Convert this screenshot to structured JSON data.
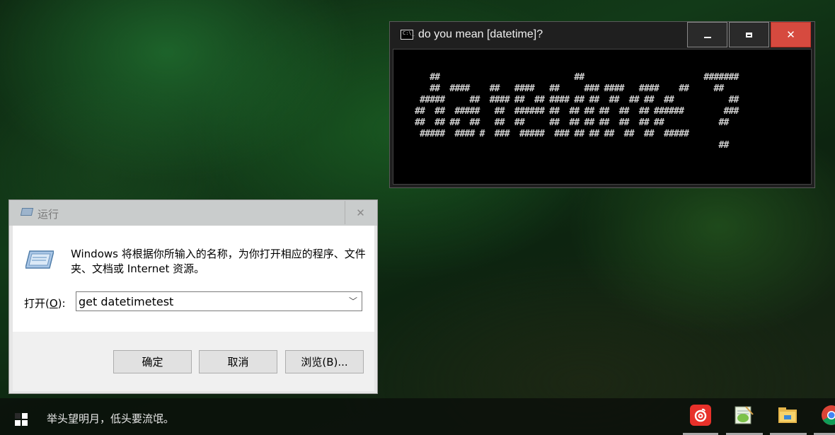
{
  "console": {
    "title": "do you mean [datetime]?",
    "ascii_art": "   ##                           ##                        #######\n   ##  ####    ##   ####   ##     ### ####   ####    ##     ##\n #####     ##  #### ##  ## #### ## ##  ##  ## ##  ##           ##\n##  ##  #####   ##  ###### ##  ## ## ##  ##  ## ######        ###\n##  ## ##  ##   ##  ##     ##  ## ## ##  ##  ## ##           ##\n #####  #### #  ###  #####  ### ## ## ##  ##  ##  #####\n                                                             ##"
  },
  "run_dialog": {
    "title": "运行",
    "description": "Windows 将根据你所输入的名称，为你打开相应的程序、文件夹、文档或 Internet 资源。",
    "open_label_prefix": "打开(",
    "open_label_key": "O",
    "open_label_suffix": "):",
    "input_value": "get datetimetest",
    "ok_label": "确定",
    "cancel_label": "取消",
    "browse_label": "浏览(B)..."
  },
  "taskbar": {
    "status_text": "举头望明月，低头要流氓。"
  },
  "colors": {
    "close_red": "#d64a3f",
    "netease_red": "#e8312a"
  }
}
